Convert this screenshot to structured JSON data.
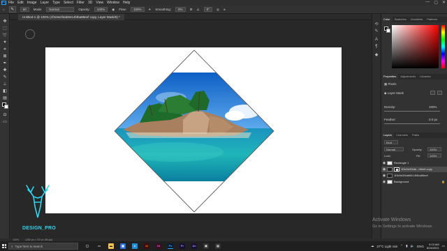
{
  "menubar": {
    "app_logo": "Ps",
    "items": [
      "File",
      "Edit",
      "Image",
      "Layer",
      "Type",
      "Select",
      "Filter",
      "3D",
      "View",
      "Window",
      "Help"
    ],
    "window_controls": [
      "—",
      "▢",
      "✕"
    ]
  },
  "options_bar": {
    "brush_size": "60",
    "mode_label": "Mode:",
    "mode_value": "Normal",
    "opacity_label": "Opacity:",
    "opacity_value": "100%",
    "flow_label": "Flow:",
    "flow_value": "100%",
    "smoothing_label": "Smoothing:",
    "smoothing_value": "0%",
    "angle_value": "0°"
  },
  "document": {
    "tab_title": "Untitled-1 @ 100% (1f3c9e2f4ab8414f4ba89eef copy, Layer Mask/8) *"
  },
  "right_panels": {
    "color_tabs": [
      "Color",
      "Swatches",
      "Gradients",
      "Patterns"
    ],
    "properties_tabs": [
      "Properties",
      "Adjustments",
      "Libraries"
    ],
    "pixels_label": "Pixels",
    "layer_mask_label": "Layer Mask",
    "density_label": "Density:",
    "density_value": "100%",
    "feather_label": "Feather:",
    "feather_value": "0.0 px",
    "layers_tabs": [
      "Layers",
      "Channels",
      "Paths"
    ],
    "kind_label": "Kind",
    "blend_mode": "Normal",
    "opacity_label": "Opacity:",
    "opacity_value": "100%",
    "lock_label": "Lock:",
    "fill_label": "Fill:",
    "fill_value": "100%",
    "layers": [
      {
        "name": "Rectangle 1",
        "selected": false
      },
      {
        "name": "1f3c9e2f4ab...d9eef copy",
        "selected": true
      },
      {
        "name": "1f3c9e2f4ab8414f4ba89eef",
        "selected": false
      },
      {
        "name": "Background",
        "selected": false
      }
    ]
  },
  "status": {
    "zoom": "100%",
    "doc_size": "1280 px x 720 px (96 ppi)"
  },
  "watermark": {
    "line1": "Activate Windows",
    "line2": "Go to Settings to activate Windows."
  },
  "brand": {
    "text": "DESIGN_PRO"
  },
  "taskbar": {
    "search_placeholder": "Type here to search",
    "weather": "27°C  Light rain",
    "lang": "ENG",
    "time": "9:03 AM",
    "date": "8/26/2021"
  },
  "colors": {
    "accent": "#31a8ff",
    "brand_cyan": "#30d5f0",
    "ui_dark": "#2b2b2b",
    "panel": "#323232"
  }
}
